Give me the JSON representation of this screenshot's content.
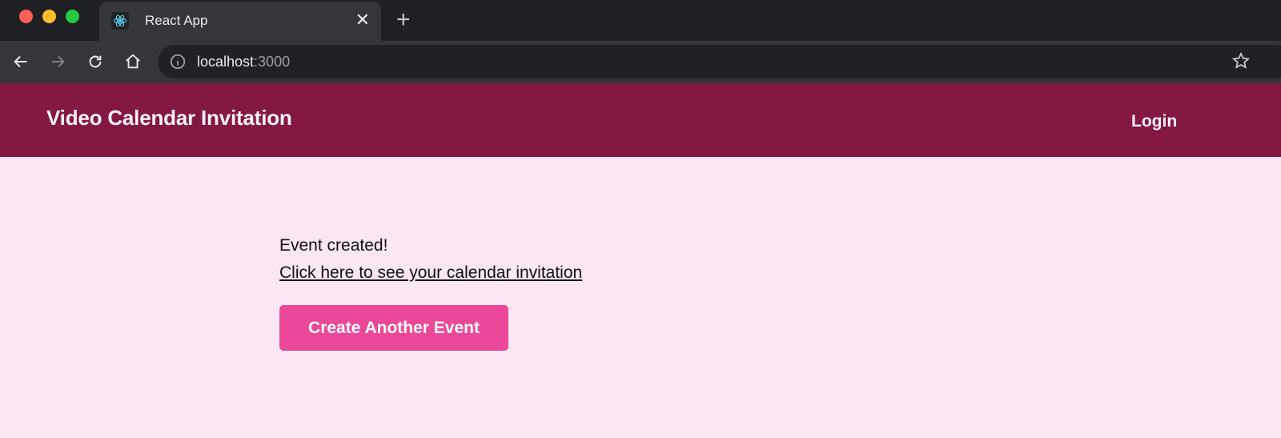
{
  "browser": {
    "tab": {
      "title": "React App",
      "favicon": "react-logo-icon"
    },
    "address": {
      "host": "localhost",
      "port": ":3000"
    },
    "icons": [
      "back-icon",
      "forward-icon",
      "reload-icon",
      "home-icon",
      "info-icon",
      "bookmark-star-icon",
      "close-icon",
      "new-tab-icon"
    ]
  },
  "header": {
    "title": "Video Calendar Invitation",
    "login_label": "Login",
    "color": "#831843"
  },
  "main": {
    "message": "Event created!",
    "link_text": "Click here to see your calendar invitation",
    "button_label": "Create Another Event",
    "button_color": "#ec4899",
    "background": "#fbe6f3"
  }
}
